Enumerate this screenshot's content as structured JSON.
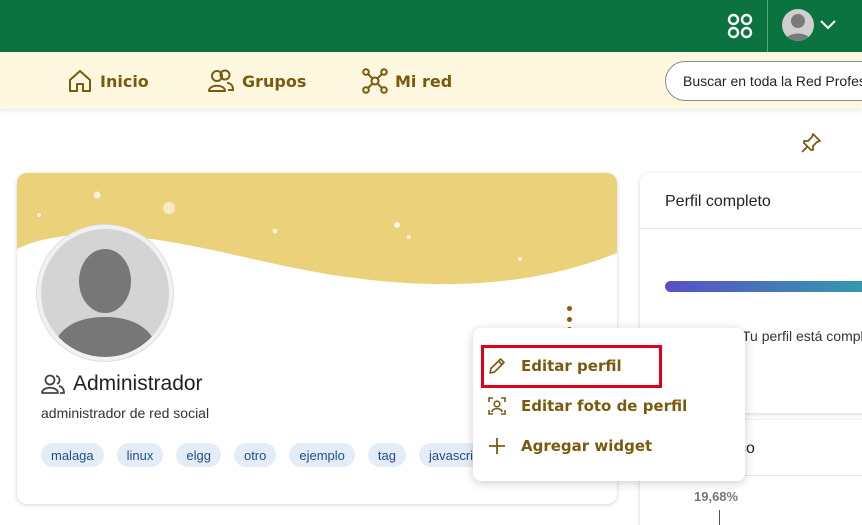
{
  "nav": {
    "inicio": "Inicio",
    "grupos": "Grupos",
    "mired": "Mi red",
    "search_placeholder": "Buscar en toda la Red Profesional"
  },
  "profile": {
    "name": "Administrador",
    "bio": "administrador de red social",
    "tags": [
      "malaga",
      "linux",
      "elgg",
      "otro",
      "ejemplo",
      "tag",
      "javascript"
    ]
  },
  "menu": {
    "edit_profile": "Editar perfil",
    "edit_photo": "Editar foto de perfil",
    "add_widget": "Agregar widget"
  },
  "side": {
    "title": "Perfil completo",
    "status_text": "Tu perfil está completo",
    "card2_title": "sco",
    "card2_value": "19,68%"
  },
  "colors": {
    "topbar": "#0a7340",
    "navbar": "#fdf8df",
    "accent": "#7a5a0e",
    "highlight": "#e0001a",
    "banner": "#ead17a"
  },
  "icons": [
    "apps-icon",
    "user-avatar-icon",
    "chevron-down-icon",
    "home-icon",
    "groups-icon",
    "network-icon",
    "pin-icon",
    "user-icon",
    "pencil-icon",
    "portrait-icon",
    "plus-icon",
    "kebab-icon"
  ]
}
